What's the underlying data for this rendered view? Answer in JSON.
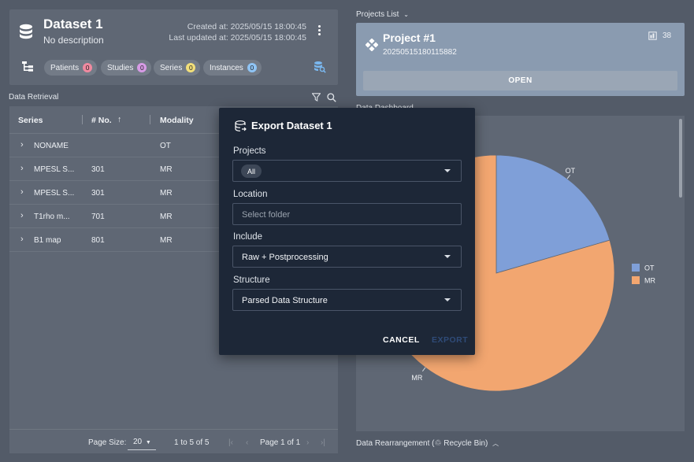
{
  "dataset": {
    "title": "Dataset 1",
    "description": "No description",
    "created": "Created at: 2025/05/15 18:00:45",
    "updated": "Last updated at: 2025/05/15 18:00:45",
    "chips": [
      {
        "label": "Patients",
        "count": "0",
        "color": "#f08aa0"
      },
      {
        "label": "Studies",
        "count": "0",
        "color": "#d79be6"
      },
      {
        "label": "Series",
        "count": "0",
        "color": "#f2df7a"
      },
      {
        "label": "Instances",
        "count": "0",
        "color": "#8fc4f5"
      }
    ]
  },
  "retrieval": {
    "title": "Data Retrieval",
    "columns": {
      "series": "Series",
      "no": "# No.",
      "sort_arrow": "↑",
      "modality": "Modality"
    },
    "rows": [
      {
        "series": "NONAME",
        "no": "",
        "modality": "OT"
      },
      {
        "series": "MPESL S...",
        "no": "301",
        "modality": "MR"
      },
      {
        "series": "MPESL S...",
        "no": "301",
        "modality": "MR"
      },
      {
        "series": "T1rho m...",
        "no": "701",
        "modality": "MR"
      },
      {
        "series": "B1 map",
        "no": "801",
        "modality": "MR"
      }
    ],
    "footer": {
      "page_size_label": "Page Size:",
      "page_size_value": "20",
      "range": "1 to 5 of 5",
      "page": "Page 1 of 1"
    }
  },
  "projects": {
    "title": "Projects List",
    "name": "Project #1",
    "id": "20250515180115882",
    "count": "38",
    "open_label": "OPEN"
  },
  "dashboard": {
    "title": "Data Dashboard",
    "rearrangement_title": "Data Rearrangement (♲ Recycle Bin)"
  },
  "chart_data": {
    "type": "pie",
    "categories": [
      "OT",
      "MR"
    ],
    "values": [
      0.205,
      0.795
    ],
    "colors": [
      "#7f9fd8",
      "#f2a670"
    ],
    "legend_position": "right"
  },
  "modal": {
    "title": "Export Dataset 1",
    "projects_label": "Projects",
    "projects_value": "All",
    "location_label": "Location",
    "location_placeholder": "Select folder",
    "include_label": "Include",
    "include_value": "Raw + Postprocessing",
    "structure_label": "Structure",
    "structure_value": "Parsed Data Structure",
    "cancel_label": "CANCEL",
    "export_label": "EXPORT"
  }
}
